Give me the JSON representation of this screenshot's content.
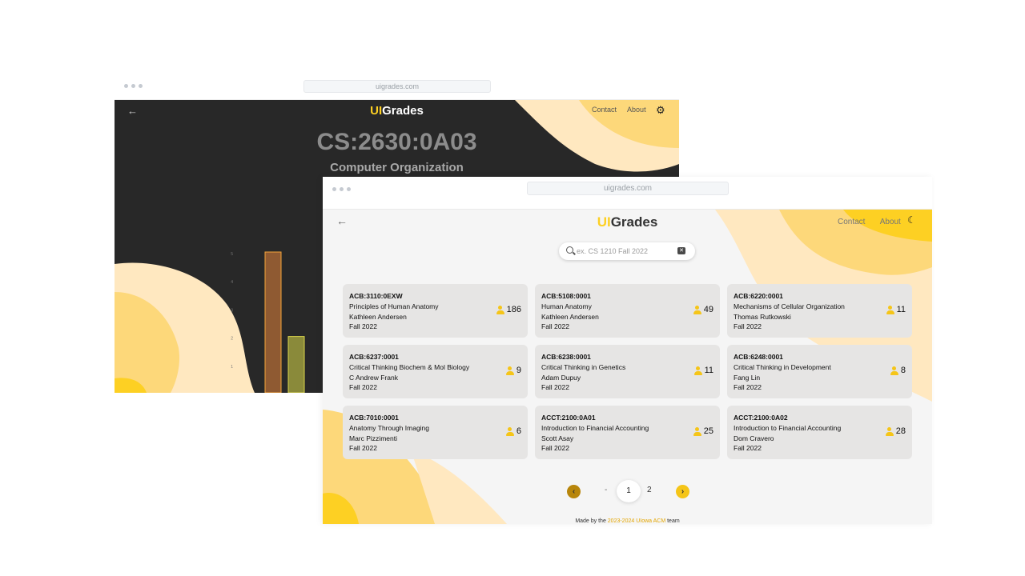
{
  "back_window": {
    "url": "uigrades.com",
    "logo_ui": "UI",
    "logo_rest": "Grades",
    "nav": {
      "contact": "Contact",
      "about": "About"
    },
    "course_code": "CS:2630:0A03",
    "course_name": "Computer Organization",
    "chart_data": {
      "type": "bar",
      "title": "",
      "xlabel": "",
      "ylabel": "",
      "ylim": [
        0,
        5
      ],
      "yticks": [
        "5",
        "4",
        "3",
        "2",
        "1"
      ],
      "categories": [
        "",
        ""
      ],
      "values": [
        5,
        2
      ],
      "colors": [
        "#8f5a32",
        "#8a8a3a"
      ],
      "visible_partial": true
    }
  },
  "front_window": {
    "url": "uigrades.com",
    "logo_ui": "UI",
    "logo_rest": "Grades",
    "nav": {
      "contact": "Contact",
      "about": "About"
    },
    "search": {
      "placeholder": "ex. CS 1210 Fall 2022",
      "value": ""
    },
    "courses": [
      {
        "code": "ACB:3110:0EXW",
        "title": "Principles of Human Anatomy",
        "instructor": "Kathleen Andersen",
        "term": "Fall 2022",
        "students": "186"
      },
      {
        "code": "ACB:5108:0001",
        "title": "Human Anatomy",
        "instructor": "Kathleen Andersen",
        "term": "Fall 2022",
        "students": "49"
      },
      {
        "code": "ACB:6220:0001",
        "title": "Mechanisms of Cellular Organization",
        "instructor": "Thomas Rutkowski",
        "term": "Fall 2022",
        "students": "11"
      },
      {
        "code": "ACB:6237:0001",
        "title": "Critical Thinking Biochem & Mol Biology",
        "instructor": "C Andrew Frank",
        "term": "Fall 2022",
        "students": "9"
      },
      {
        "code": "ACB:6238:0001",
        "title": "Critical Thinking in Genetics",
        "instructor": "Adam Dupuy",
        "term": "Fall 2022",
        "students": "11"
      },
      {
        "code": "ACB:6248:0001",
        "title": "Critical Thinking in Development",
        "instructor": "Fang Lin",
        "term": "Fall 2022",
        "students": "8"
      },
      {
        "code": "ACB:7010:0001",
        "title": "Anatomy Through Imaging",
        "instructor": "Marc Pizzimenti",
        "term": "Fall 2022",
        "students": "6"
      },
      {
        "code": "ACCT:2100:0A01",
        "title": "Introduction to Financial Accounting",
        "instructor": "Scott Asay",
        "term": "Fall 2022",
        "students": "25"
      },
      {
        "code": "ACCT:2100:0A02",
        "title": "Introduction to Financial Accounting",
        "instructor": "Dom Cravero",
        "term": "Fall 2022",
        "students": "28"
      }
    ],
    "pagination": {
      "prev": "‹",
      "dash": "-",
      "page1": "1",
      "page2": "2",
      "next": "›"
    },
    "footer": {
      "pre": "Made by the ",
      "highlight": "2023-2024 UIowa ACM",
      "post": " team"
    }
  },
  "colors": {
    "brand_yellow": "#fdd023",
    "dark_bg": "#282828",
    "card_bg": "#e6e5e4"
  },
  "icons": [
    "back-arrow-icon",
    "gear-icon",
    "moon-icon",
    "search-icon",
    "clear-icon",
    "person-icon",
    "chevron-left-icon",
    "chevron-right-icon"
  ]
}
